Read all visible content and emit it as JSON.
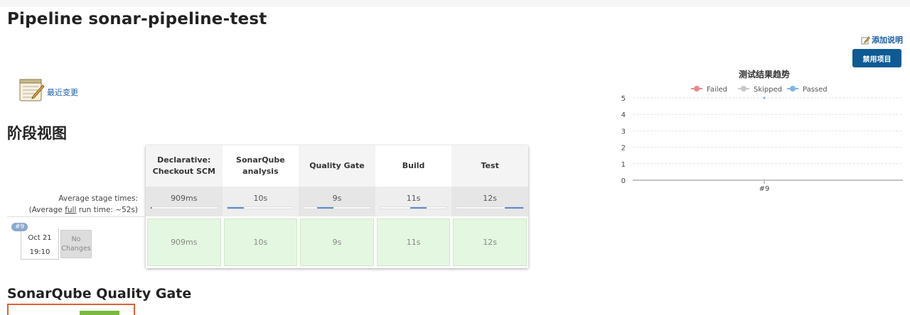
{
  "page": {
    "title": "Pipeline sonar-pipeline-test",
    "add_description": "添加说明",
    "disable_button": "禁用项目",
    "recent_changes": "最近变更",
    "stage_view_heading": "阶段视图",
    "quality_gate_heading": "SonarQube Quality Gate"
  },
  "stage_view": {
    "stages": [
      {
        "name_line1": "Declarative:",
        "name_line2": "Checkout SCM",
        "avg": "909ms",
        "run": "909ms",
        "fill_from": 0.0,
        "fill_to": 0.02
      },
      {
        "name_line1": "SonarQube",
        "name_line2": "analysis",
        "avg": "10s",
        "run": "10s",
        "fill_from": 0.0,
        "fill_to": 0.25
      },
      {
        "name_line1": "Quality Gate",
        "name_line2": "",
        "avg": "9s",
        "run": "9s",
        "fill_from": 0.2,
        "fill_to": 0.45
      },
      {
        "name_line1": "Build",
        "name_line2": "",
        "avg": "11s",
        "run": "11s",
        "fill_from": 0.45,
        "fill_to": 0.7
      },
      {
        "name_line1": "Test",
        "name_line2": "",
        "avg": "12s",
        "run": "12s",
        "fill_from": 0.72,
        "fill_to": 1.0
      }
    ],
    "avg_label_line1": "Average stage times:",
    "avg_label_prefix": "(Average ",
    "avg_label_full": "full",
    "avg_label_suffix": " run time: ~52s)",
    "build": {
      "number": "#9",
      "date": "Oct 21",
      "time": "19:10",
      "no_changes_line1": "No",
      "no_changes_line2": "Changes"
    }
  },
  "chart_data": {
    "type": "line",
    "title": "测试结果趋势",
    "legend": [
      "Failed",
      "Skipped",
      "Passed"
    ],
    "legend_colors": [
      "#e88a8a",
      "#c8c8c8",
      "#7db5e8"
    ],
    "categories": [
      "#9"
    ],
    "series": [
      {
        "name": "Failed",
        "values": [
          0
        ]
      },
      {
        "name": "Skipped",
        "values": [
          0
        ]
      },
      {
        "name": "Passed",
        "values": [
          5
        ]
      }
    ],
    "yticks": [
      0,
      1,
      2,
      3,
      4,
      5
    ],
    "ylim": [
      0,
      5
    ],
    "legend_position": "top"
  }
}
